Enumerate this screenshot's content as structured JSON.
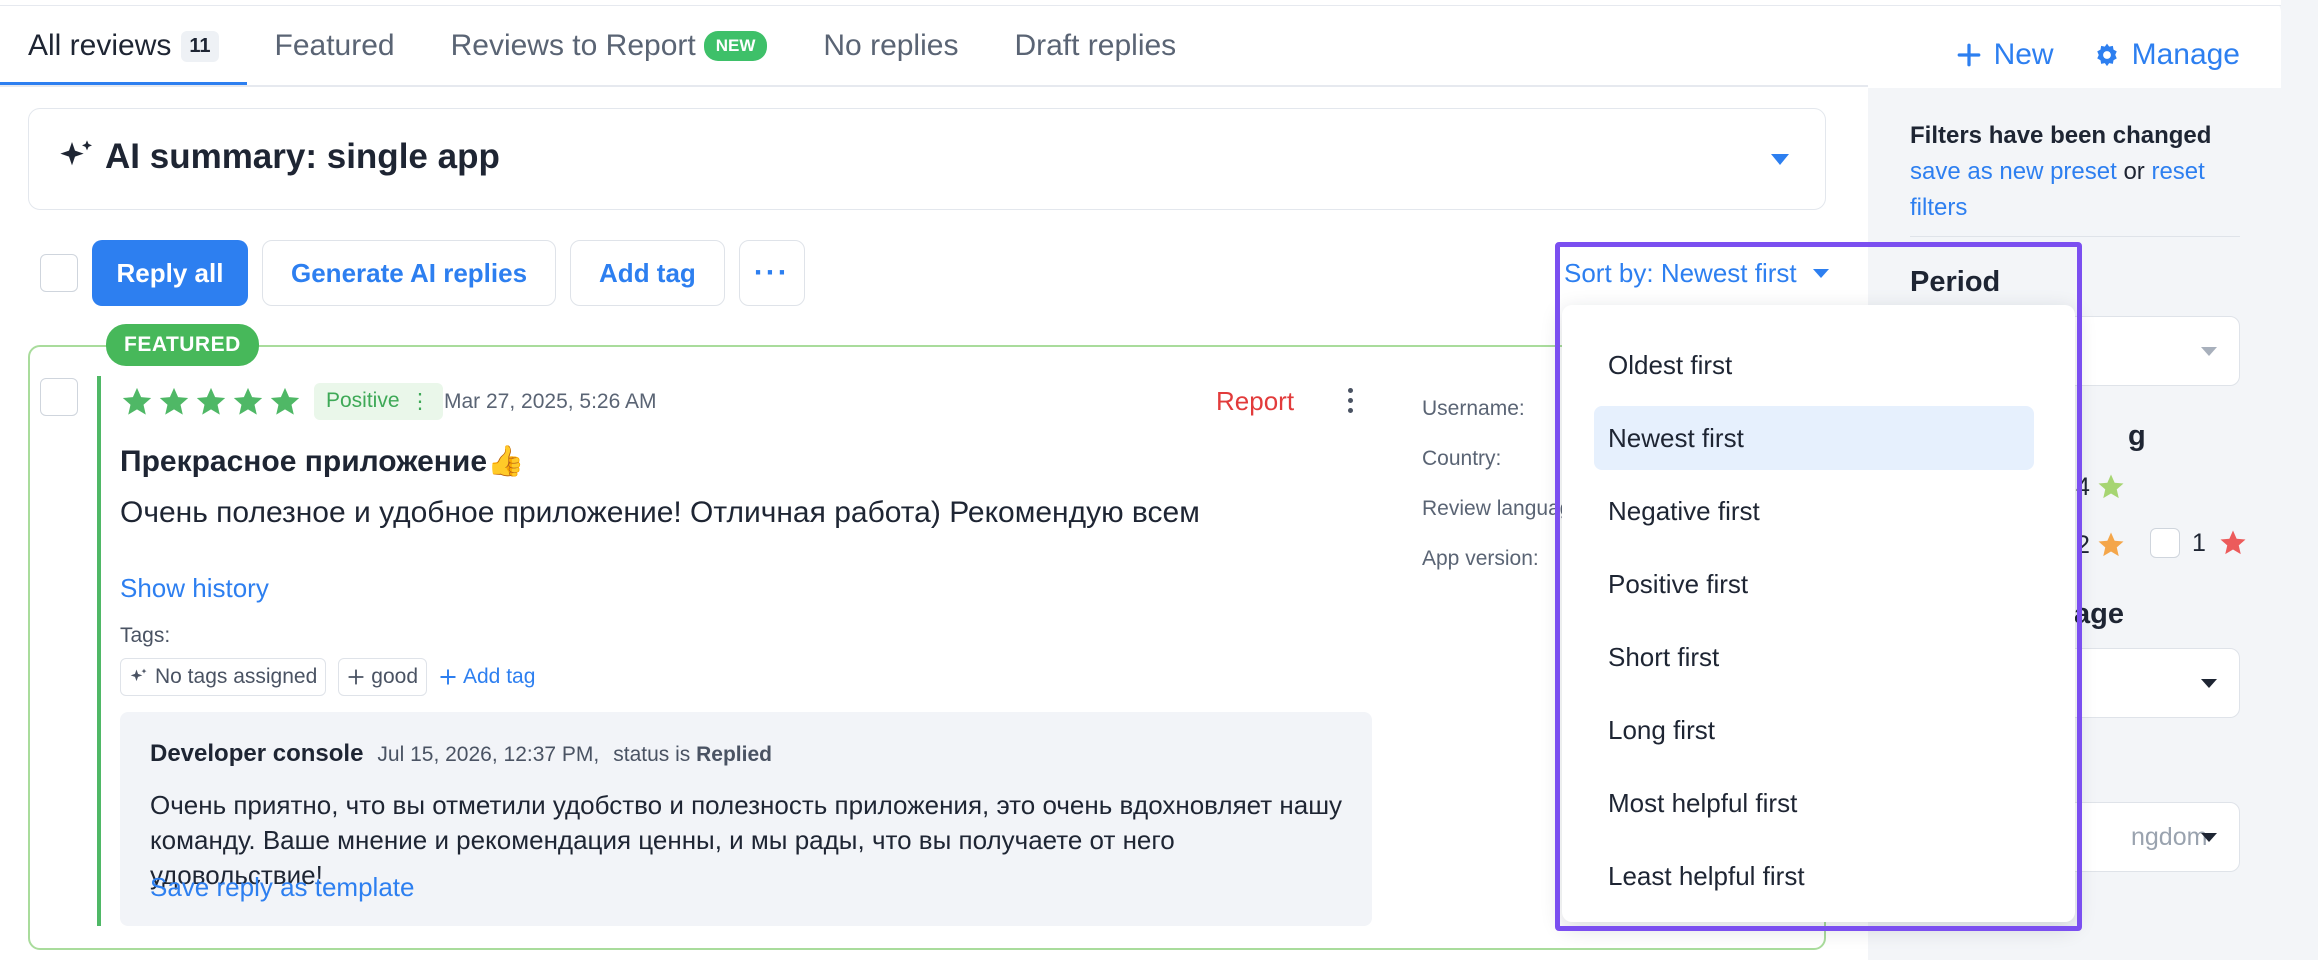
{
  "tabs": [
    {
      "label": "All reviews",
      "count": "11"
    },
    {
      "label": "Featured"
    },
    {
      "label": "Reviews to Report",
      "badge": "NEW"
    },
    {
      "label": "No replies"
    },
    {
      "label": "Draft replies"
    }
  ],
  "actions": {
    "new_label": "New",
    "manage_label": "Manage"
  },
  "ai_summary": {
    "title": "AI summary: single app"
  },
  "toolbar": {
    "reply_all": "Reply all",
    "generate_ai": "Generate AI replies",
    "add_tag": "Add tag",
    "more": "···"
  },
  "sort": {
    "label": "Sort by: Newest first",
    "options": [
      "Oldest first",
      "Newest first",
      "Negative first",
      "Positive first",
      "Short first",
      "Long first",
      "Most helpful first",
      "Least helpful first"
    ],
    "selected": "Newest first"
  },
  "review": {
    "featured_badge": "FEATURED",
    "rating": 5,
    "sentiment": "Positive",
    "sentiment_menu": "⋮",
    "date": "Mar 27, 2025, 5:26 AM",
    "report": "Report",
    "title": "Прекрасное приложение👍",
    "text": "Очень полезное и удобное приложение! Отличная работа) Рекомендую всем",
    "show_history": "Show history",
    "tags_label": "Tags:",
    "tag_ai": "No tags assigned",
    "tag_good": "good",
    "add_tag": "Add tag",
    "meta": {
      "username": "Username:",
      "country": "Country:",
      "language": "Review language",
      "version": "App version:"
    },
    "reply": {
      "author": "Developer console",
      "date": "Jul 15, 2026, 12:37 PM,",
      "status_prefix": "status is",
      "status": "Replied",
      "text": "Очень приятно, что вы отметили удобство и полезность приложения, это очень вдохновляет нашу команду. Ваше мнение и рекомендация ценны, и мы рады, что вы получаете от него удовольствие!",
      "save_template": "Save reply as template"
    }
  },
  "sidebar": {
    "changed_title": "Filters have been changed",
    "save_preset": "save as new preset",
    "or": "or",
    "reset": "reset filters",
    "period": "Period",
    "rating_partial": "g",
    "rating_4": "4",
    "rating_2": "2",
    "rating_1": "1",
    "language_partial": "age",
    "country_partial": "ngdom"
  },
  "colors": {
    "accent": "#2d7ff0",
    "featured": "#47b85a",
    "danger": "#e23b3b",
    "highlight": "#7b4ff0",
    "star_green": "#4fb866",
    "star_light_green": "#a6d572",
    "star_orange": "#f4a64a",
    "star_red": "#ec5b5b"
  }
}
